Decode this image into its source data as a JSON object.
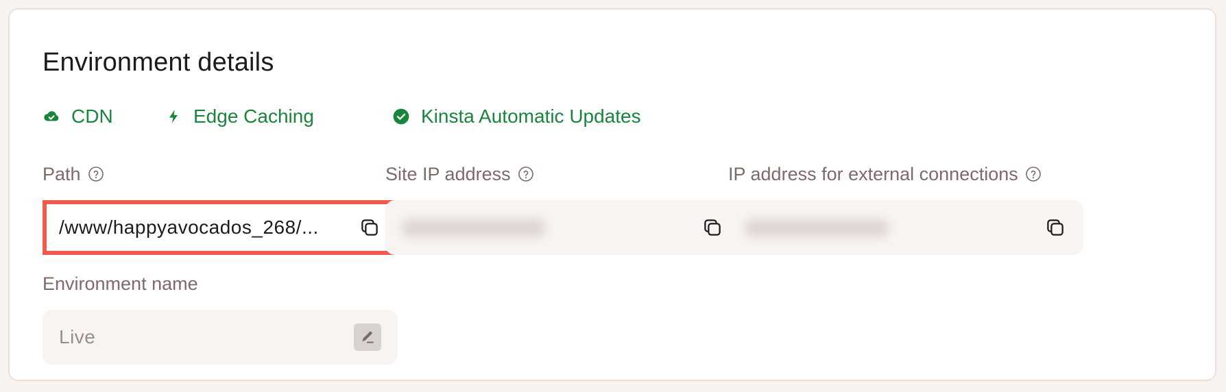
{
  "panel": {
    "title": "Environment details"
  },
  "features": [
    {
      "label": "CDN",
      "icon": "cloud-check-icon",
      "color": "#19843c"
    },
    {
      "label": "Edge Caching",
      "icon": "bolt-icon",
      "color": "#19843c"
    },
    {
      "label": "Kinsta Automatic Updates",
      "icon": "check-circle-icon",
      "color": "#19843c"
    }
  ],
  "fields": {
    "path": {
      "label": "Path",
      "value": "/www/happyavocados_268/...",
      "highlighted": true,
      "highlight_color": "#f05a4f"
    },
    "site_ip": {
      "label": "Site IP address",
      "value_blurred": true
    },
    "external_ip": {
      "label": "IP address for external connections",
      "value_blurred": true
    },
    "environment_name": {
      "label": "Environment name",
      "value": "Live"
    }
  }
}
